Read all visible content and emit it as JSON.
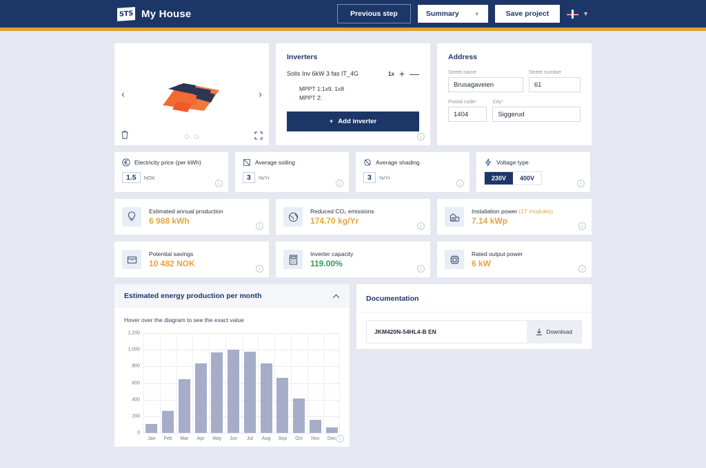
{
  "header": {
    "logo_text": "STS",
    "brand_name": "My House",
    "previous_step": "Previous step",
    "summary": "Summary",
    "save_project": "Save project"
  },
  "viewer": {
    "alt": "solar-roof-3d-model"
  },
  "inverters": {
    "title": "Inverters",
    "model": "Solis Inv 6kW 3 fas IT_4G",
    "count": "1x",
    "plus": "+",
    "minus": "—",
    "mppt1": "MPPT 1:1x9, 1x8",
    "mppt2": "MPPT 2:",
    "add_button": "Add inverter"
  },
  "address": {
    "title": "Address",
    "street_name_label": "Street name",
    "street_name_value": "Brusagaveien",
    "street_number_label": "Street number",
    "street_number_value": "61",
    "postal_code_label": "Postal code",
    "postal_code_value": "1404",
    "city_label": "City",
    "city_value": "Siggerud"
  },
  "metrics": [
    {
      "label": "Electricity price (per kWh)",
      "value": "1.5",
      "unit": "NOK",
      "icon": "euro-icon"
    },
    {
      "label": "Average soiling",
      "value": "3",
      "unit": "%/Yr",
      "icon": "soiling-icon"
    },
    {
      "label": "Average shading",
      "value": "3",
      "unit": "%/Yr",
      "icon": "shading-icon"
    }
  ],
  "voltage": {
    "label": "Voltage type",
    "options": [
      "230V",
      "400V"
    ],
    "selected": "230V"
  },
  "stats": [
    {
      "label": "Estimated annual production",
      "value": "6 988 kWh",
      "icon": "bulb-icon",
      "color": "orange"
    },
    {
      "label": "Reduced CO₂ emissions",
      "value": "174.70 kg/Yr",
      "icon": "globe-icon",
      "color": "orange"
    },
    {
      "label": "Installation power",
      "sublabel": "(17 modules)",
      "value": "7.14 kWp",
      "icon": "building-icon",
      "color": "orange"
    },
    {
      "label": "Potential savings",
      "value": "10 482 NOK",
      "icon": "wallet-icon",
      "color": "orange"
    },
    {
      "label": "Inverter capacity",
      "value": "119.00%",
      "icon": "calculator-icon",
      "color": "green"
    },
    {
      "label": "Rated output power",
      "value": "6 kW",
      "icon": "chip-icon",
      "color": "orange"
    }
  ],
  "chart_panel": {
    "title": "Estimated energy production per month",
    "hint": "Hover over the diagram to see the exact value"
  },
  "documentation": {
    "title": "Documentation",
    "file_name": "JKM420N-54HL4-B EN",
    "download_label": "Download"
  },
  "chart_data": {
    "type": "bar",
    "title": "Estimated energy production per month",
    "categories": [
      "Jan",
      "Feb",
      "Mar",
      "Apr",
      "May",
      "Jun",
      "Jul",
      "Aug",
      "Sep",
      "Oct",
      "Nov",
      "Dec"
    ],
    "values": [
      110,
      265,
      645,
      835,
      970,
      1000,
      980,
      840,
      660,
      410,
      160,
      65
    ],
    "xlabel": "",
    "ylabel": "",
    "ylim": [
      0,
      1200
    ],
    "yticks": [
      0,
      200,
      400,
      600,
      800,
      1000,
      1200
    ],
    "ytick_labels": [
      "0",
      "200",
      "400",
      "600",
      "800",
      "1,000",
      "1,200"
    ],
    "grid": true,
    "legend": false,
    "bar_color": "#a5adc8"
  }
}
